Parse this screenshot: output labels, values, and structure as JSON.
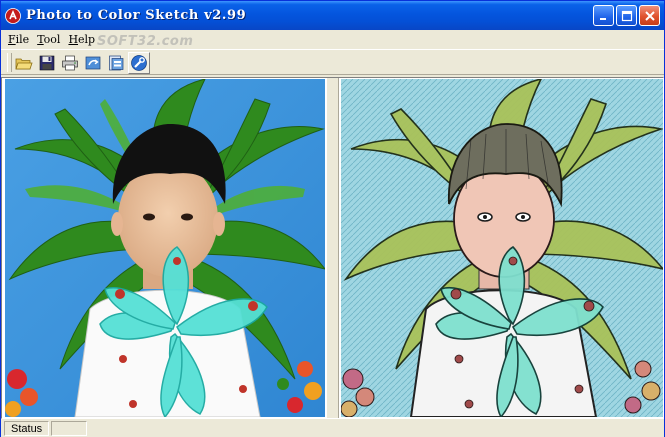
{
  "window": {
    "title": "Photo to Color Sketch v2.99",
    "accent": "#0a62e8",
    "close_color": "#e0522e"
  },
  "menu": {
    "items": [
      {
        "first": "F",
        "rest": "ile"
      },
      {
        "first": "T",
        "rest": "ool"
      },
      {
        "first": "H",
        "rest": "elp"
      }
    ]
  },
  "watermark": "SOFT32.com",
  "toolbar": {
    "icons": [
      "open-folder-icon",
      "save-disk-icon",
      "print-icon",
      "convert-icon",
      "preview-icon",
      "tools-icon"
    ]
  },
  "panels": {
    "left": "original-photo",
    "right": "color-sketch-result"
  },
  "status": {
    "label": "Status",
    "extra": ""
  }
}
